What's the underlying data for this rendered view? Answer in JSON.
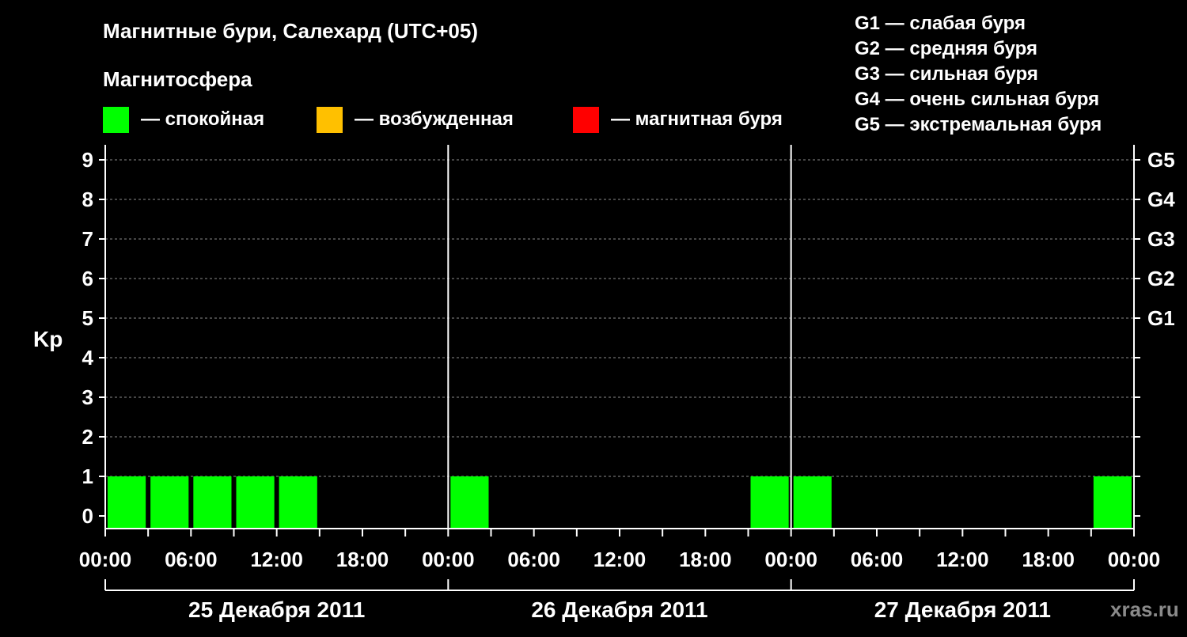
{
  "chart_data": {
    "type": "bar",
    "title": "Магнитные бури, Салехард (UTC+05)",
    "subtitle": "Магнитосфера",
    "ylabel": "Kp",
    "ylim": [
      0,
      9
    ],
    "grid": true,
    "y_ticks": [
      "0",
      "1",
      "2",
      "3",
      "4",
      "5",
      "6",
      "7",
      "8",
      "9"
    ],
    "storm_levels": [
      {
        "kp": 5,
        "label": "G1"
      },
      {
        "kp": 6,
        "label": "G2"
      },
      {
        "kp": 7,
        "label": "G3"
      },
      {
        "kp": 8,
        "label": "G4"
      },
      {
        "kp": 9,
        "label": "G5"
      }
    ],
    "x_ticks": [
      "00:00",
      "06:00",
      "12:00",
      "18:00",
      "00:00",
      "06:00",
      "12:00",
      "18:00",
      "00:00",
      "06:00",
      "12:00",
      "18:00",
      "00:00"
    ],
    "days": [
      "25 Декабря 2011",
      "26 Декабря 2011",
      "27 Декабря 2011"
    ],
    "bars_per_day": 8,
    "bar_hours": 3,
    "series": [
      {
        "state": "quiet",
        "color": "#00ff00",
        "values": [
          1,
          1,
          1,
          1,
          1,
          0,
          0,
          0,
          1,
          0,
          0,
          0,
          0,
          0,
          0,
          1,
          1,
          0,
          0,
          0,
          0,
          0,
          0,
          1
        ]
      }
    ]
  },
  "legend": {
    "states": [
      {
        "color": "#00ff00",
        "label": "— спокойная"
      },
      {
        "color": "#ffc000",
        "label": "— возбужденная"
      },
      {
        "color": "#ff0000",
        "label": "— магнитная буря"
      }
    ],
    "storm_scale": [
      "G1 — слабая буря",
      "G2 — средняя буря",
      "G3 — сильная буря",
      "G4 — очень сильная буря",
      "G5 — экстремальная буря"
    ]
  },
  "watermark": "xras.ru"
}
